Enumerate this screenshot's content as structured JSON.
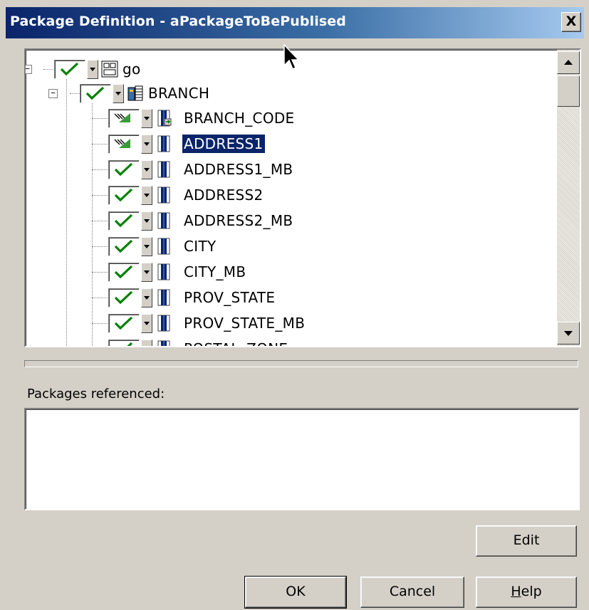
{
  "window": {
    "title": "Package Definition - aPackageToBePublised",
    "close_symbol": "X"
  },
  "tree": {
    "root": {
      "label": "go",
      "expander": "−",
      "check": "checked",
      "icon": "package-icon"
    },
    "branch": {
      "label": "BRANCH",
      "expander": "−",
      "check": "checked",
      "icon": "table-icon"
    },
    "columns": [
      {
        "label": "BRANCH_CODE",
        "check": "partial",
        "icon": "key-column-icon",
        "selected": false
      },
      {
        "label": "ADDRESS1",
        "check": "partial",
        "icon": "column-icon",
        "selected": true
      },
      {
        "label": "ADDRESS1_MB",
        "check": "checked",
        "icon": "column-icon",
        "selected": false
      },
      {
        "label": "ADDRESS2",
        "check": "checked",
        "icon": "column-icon",
        "selected": false
      },
      {
        "label": "ADDRESS2_MB",
        "check": "checked",
        "icon": "column-icon",
        "selected": false
      },
      {
        "label": "CITY",
        "check": "checked",
        "icon": "column-icon",
        "selected": false
      },
      {
        "label": "CITY_MB",
        "check": "checked",
        "icon": "column-icon",
        "selected": false
      },
      {
        "label": "PROV_STATE",
        "check": "checked",
        "icon": "column-icon",
        "selected": false
      },
      {
        "label": "PROV_STATE_MB",
        "check": "checked",
        "icon": "column-icon",
        "selected": false
      },
      {
        "label": "POSTAL_ZONE",
        "check": "checked",
        "icon": "column-icon",
        "selected": false
      }
    ]
  },
  "packages": {
    "label": "Packages referenced:",
    "items": []
  },
  "buttons": {
    "edit": "Edit",
    "ok": "OK",
    "cancel": "Cancel",
    "help": "Help"
  },
  "colors": {
    "face": "#d4d0c8",
    "title_start": "#0a246a",
    "title_end": "#a6caf0",
    "selection": "#0a246a",
    "check_green": "#008000"
  }
}
